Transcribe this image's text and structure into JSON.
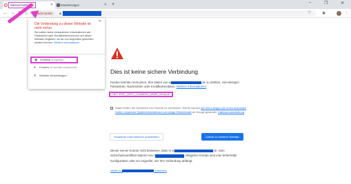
{
  "tabs": [
    {
      "label": "Datenschutzfehler",
      "active": true
    },
    {
      "label": "Erweiterungen",
      "active": false
    }
  ],
  "window_controls": {
    "minimize": "–",
    "restore": "❐",
    "close": "✕",
    "menu": "⌄"
  },
  "toolbar": {
    "back": "←",
    "forward": "→",
    "reload": "↻",
    "home": "⌂",
    "security_chip_label": "Nicht sicher",
    "url_prefix": "w",
    "star": "☆",
    "puzzle": "✱",
    "more": "⋮"
  },
  "popup": {
    "title": "Die Verbindung zu dieser Website ist nicht sicher",
    "body": "Sie sollten keine vertraulichen Informationen wie Passwörter oder Kreditkartennummern auf dieser Website eingeben, da sie von Angreifern gestohlen werden können.",
    "more_info_link": "Weitere Informationen",
    "items": [
      {
        "label": "Zertifikat",
        "note": "(Ungültig)",
        "icon": "certificate-icon"
      },
      {
        "label": "Cookies",
        "note": "(0 werden verwendet)",
        "icon": "cookie-icon"
      },
      {
        "label": "Website-Einstellungen",
        "note": "",
        "icon": "gear-icon"
      }
    ]
  },
  "interstitial": {
    "title": "Dies ist keine sichere Verbindung",
    "desc_part1": "Hacker könnten versuchen, Ihre Daten von ",
    "desc_domain_prefix": "w",
    "desc_domain_suffix": ".de",
    "desc_part2": " zu stehlen, zum Beispiel Passwörter, Nachrichten oder Kreditkartendaten. ",
    "desc_link": "Weitere Informationen",
    "error_code": "NET::ERR_CERT_COMMON_NAME_INVALID",
    "checkbox_prefix": "Dabei helfen, die Sicherheit von Chrome zu verbessern. Hierfür werden ",
    "checkbox_link1": "die URLs einiger von Ihnen besuchten Seiten, begrenzte Systeminformationen und einige Seiteninhalte",
    "checkbox_suffix": " an Google gesendet. ",
    "checkbox_link2": "Datenschutzerklärung",
    "advanced_button": "Erweiterte Informationen ausblenden",
    "back_button": "Zurück zu sicherer Website",
    "advanced_desc1": "Dieser Server konnte nicht beweisen, dass er ",
    "advanced_desc1_domain": "w",
    "advanced_desc1_tail": "ist. Sein",
    "advanced_desc2": "Sicherheitszertifikat stammt von *",
    "advanced_desc2_tail": ". Mögliche Gründe sind eine fehlerhafte",
    "advanced_desc3": "Konfiguration oder ein Angreifer, der Ihre Verbindung abfängt.",
    "proceed_prefix": "Weiter zu ",
    "proceed_suffix": " (unsicher)"
  },
  "colors": {
    "annotation_magenta": "#d63ed0",
    "danger_red": "#d93025",
    "link_blue": "#1a73e8",
    "redaction_blue": "#0b56c8"
  }
}
